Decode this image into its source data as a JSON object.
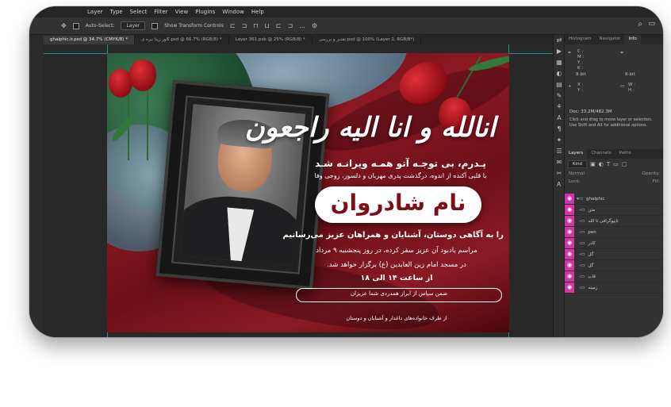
{
  "menu": [
    "Layer",
    "Type",
    "Select",
    "Filter",
    "View",
    "Plugins",
    "Window",
    "Help"
  ],
  "options": {
    "auto_select_label": "Auto-Select:",
    "auto_select_value": "Layer",
    "transform_label": "Show Transform Controls",
    "more_icon": "..."
  },
  "tabs": [
    {
      "label": "ghalphic.ir.psd @ 34.7% (CMYK/8) *"
    },
    {
      "label": "کاور زینا نیره ی.psd @ 66.7% (RGB/8) *"
    },
    {
      "label": "Layer 361.psb @ 25% (RGB/8) *"
    },
    {
      "label": "تقدیر و بررسی.psd @ 100% (Layer 2, RGB/8*)"
    }
  ],
  "poster": {
    "title": "انالله و انا الیه راجعون",
    "line1": "پـدرم، بی توجـه آتو همـه ویرانـه شـد",
    "line2": "با قلبی آکنده از اندوه، درگذشت پدری مهربان و دلسوز، زوجی وفا",
    "name": "نام شادروان",
    "line3": "را به آگاهی دوستان، آشنایان و همراهان عزیز می‌رسانیم",
    "line4": "مراسم یادبود آن عزیز سفر کرده، در روز پنجشنبه ۹ مرداد",
    "line5": "در مسجد امام زین العابدین (ع) برگزار خواهد شد.",
    "line6": "از ساعت ۱۴ الی ۱۸",
    "line7": "ضمن سپاس از ابراز همدردی شما عزیزان",
    "line8": "از طرف خانواده‌های داغدار و آشنایان و دوستان"
  },
  "panel": {
    "tabs": [
      "Histogram",
      "Navigator",
      "Info"
    ],
    "info": {
      "c": "C :",
      "m": "M :",
      "y": "Y :",
      "k": "K :",
      "bit": "8-bit",
      "x": "X :",
      "yy": "Y :",
      "w": "W :",
      "h": "H :"
    },
    "doc_size": "Doc: 33.2M/482.3M",
    "hint": "Click and drag to move layer or selection. Use Shift and Alt for additional options.",
    "layers_tabs": [
      "Layers",
      "Channels",
      "Paths"
    ],
    "kind": "Kind",
    "blend": "Normal",
    "opacity": "Opacity:",
    "lock": "Lock:",
    "fill": "Fill:",
    "layers": [
      {
        "name": "ghalphic",
        "group": true
      },
      {
        "name": "متن",
        "group": true
      },
      {
        "name": "تایپوگرافی تا الله",
        "group": true
      },
      {
        "name": "pen",
        "group": true
      },
      {
        "name": "کادر",
        "group": true
      },
      {
        "name": "گل",
        "group": true
      },
      {
        "name": "گل",
        "group": true
      },
      {
        "name": "قاب",
        "group": true
      },
      {
        "name": "زمینه",
        "group": true
      }
    ]
  },
  "colors": {
    "accent_eye": "#d235a8",
    "poster_red": "#8d1822",
    "name_text": "#7c0f18"
  }
}
